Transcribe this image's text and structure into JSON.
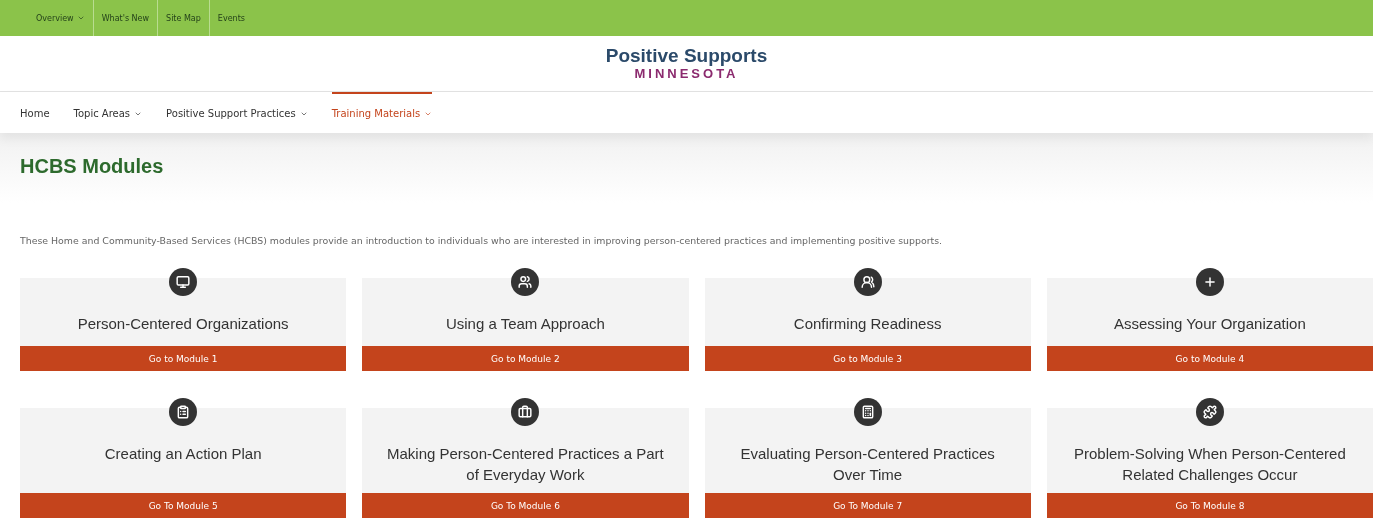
{
  "top_bar": [
    {
      "label": "Overview",
      "has_menu": true
    },
    {
      "label": "What's New",
      "has_menu": false
    },
    {
      "label": "Site Map",
      "has_menu": false
    },
    {
      "label": "Events",
      "has_menu": false
    }
  ],
  "logo": {
    "line_1": "Positive Supports",
    "line_2": "MINNESOTA"
  },
  "main_nav": [
    {
      "label": "Home",
      "has_menu": false,
      "selected": false
    },
    {
      "label": "Topic Areas",
      "has_menu": true,
      "selected": false
    },
    {
      "label": "Positive Support Practices",
      "has_menu": true,
      "selected": false
    },
    {
      "label": "Training Materials",
      "has_menu": true,
      "selected": true
    }
  ],
  "page_title": "HCBS Modules",
  "intro": "These Home and Community-Based Services (HCBS) modules provide an introduction to individuals who are interested in improving person-centered practices and implementing positive supports.",
  "modules": [
    {
      "kind": "monitor",
      "title": "Person-Centered Organizations",
      "button": "Go to Module 1"
    },
    {
      "kind": "team",
      "title": "Using a Team Approach",
      "button": "Go to Module 2"
    },
    {
      "kind": "pair",
      "title": "Confirming Readiness",
      "button": "Go to Module 3"
    },
    {
      "kind": "plus",
      "title": "Assessing Your Organization",
      "button": "Go to Module 4"
    },
    {
      "kind": "clipboard",
      "title": "Creating an Action Plan",
      "button": "Go To Module 5"
    },
    {
      "kind": "briefcase",
      "title": "Making Person-Centered Practices a Part of Everyday Work",
      "button": "Go To Module 6"
    },
    {
      "kind": "calculator",
      "title": "Evaluating Person-Centered Practices Over Time",
      "button": "Go To Module 7"
    },
    {
      "kind": "puzzle",
      "title": "Problem-Solving When Person-Centered Related Challenges Occur",
      "button": "Go To Module 8"
    }
  ]
}
